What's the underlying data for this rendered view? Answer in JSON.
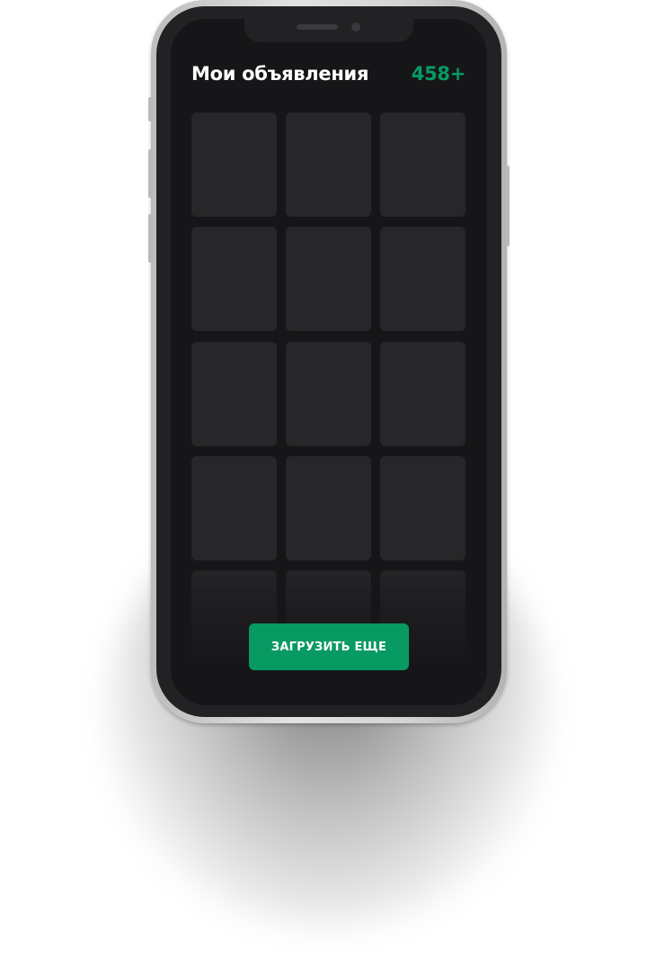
{
  "header": {
    "title": "Мои объявления",
    "count": "458+"
  },
  "grid": {
    "columns": 3,
    "visible_rows": 5
  },
  "actions": {
    "load_more_label": "ЗАГРУЗИТЬ ЕЩЕ"
  },
  "colors": {
    "accent": "#079a63",
    "screen_bg": "#161618",
    "tile_bg": "#272729"
  }
}
